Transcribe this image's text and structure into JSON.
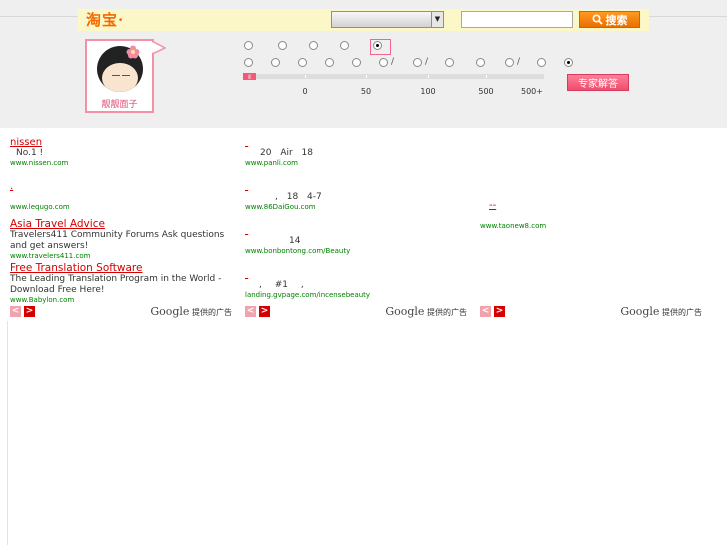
{
  "header": {
    "logo_text": "淘宝·",
    "search_button": "搜索",
    "select_value": ""
  },
  "avatar": {
    "name": "靓靓面子"
  },
  "filters": {
    "row1": [
      "",
      "",
      "",
      "",
      ""
    ],
    "row2_slashes": [
      "/",
      "/",
      "/",
      "/"
    ],
    "price_labels": [
      "0",
      "50",
      "100",
      "500",
      "500+"
    ],
    "expert_button": "专家解答"
  },
  "ads": {
    "col1": [
      {
        "title": "nissen",
        "desc": "No.1 !",
        "url": "www.nissen.com"
      },
      {
        "title": ".",
        "desc": "",
        "url": "www.lequgo.com"
      },
      {
        "title": "Asia Travel Advice",
        "desc": "Travelers411 Community Forums Ask questions and get answers!",
        "url": "www.travelers411.com"
      },
      {
        "title": "Free Translation Software",
        "desc": "The Leading Translation Program in the World - Download Free Here!",
        "url": "www.Babylon.com"
      }
    ],
    "col2": [
      {
        "title": "",
        "desc": "20 Air 18",
        "url": "www.panli.com"
      },
      {
        "title": "",
        "desc": ", 18 4-7",
        "url": "www.86DaiGou.com"
      },
      {
        "title": "",
        "desc": "14",
        "url": "www.bonbontong.com/Beauty"
      },
      {
        "title": "",
        "desc": ", #1 ,",
        "url": "landing.gvpage.com/incensebeauty"
      }
    ],
    "col3": [
      {
        "title": "--",
        "desc": "",
        "url": "www.taonew8.com"
      }
    ],
    "google_label": "Google",
    "google_suffix": "提供的广告",
    "prev": "<",
    "next": ">"
  }
}
